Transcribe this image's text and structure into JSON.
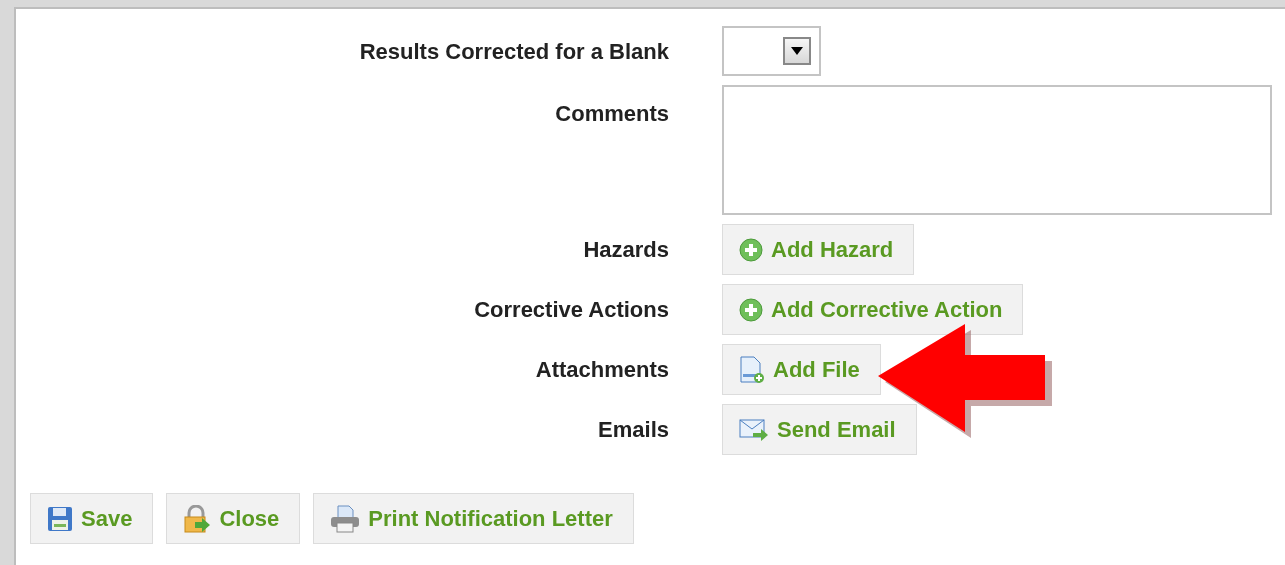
{
  "form_rows": [
    {
      "label": "Results Corrected for a Blank",
      "kind": "select"
    },
    {
      "label": "Comments",
      "kind": "textarea"
    },
    {
      "label": "Hazards",
      "kind": "button",
      "button": {
        "label": "Add Hazard",
        "kind": "add"
      }
    },
    {
      "label": "Corrective Actions",
      "kind": "button",
      "button": {
        "label": "Add Corrective Action",
        "kind": "add"
      }
    },
    {
      "label": "Attachments",
      "kind": "button",
      "button": {
        "label": "Add File",
        "kind": "file"
      }
    },
    {
      "label": "Emails",
      "kind": "button",
      "button": {
        "label": "Send Email",
        "kind": "email"
      }
    }
  ],
  "footer_buttons": [
    {
      "label": "Save",
      "kind": "save"
    },
    {
      "label": "Close",
      "kind": "close"
    },
    {
      "label": "Print Notification Letter",
      "kind": "print"
    }
  ]
}
